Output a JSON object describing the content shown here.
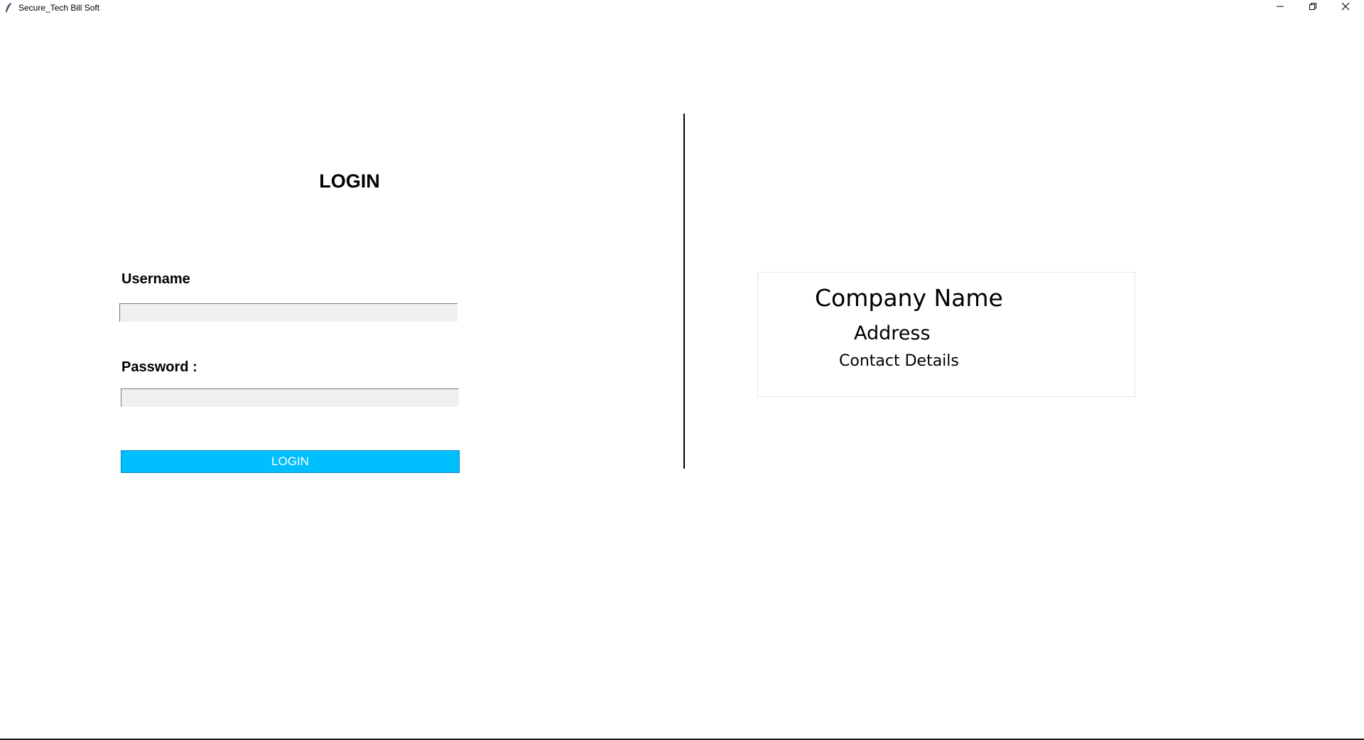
{
  "window": {
    "title": "Secure_Tech Bill Soft",
    "icon": "feather-icon",
    "controls": {
      "minimize_icon": "minimize-icon",
      "maximize_icon": "restore-icon",
      "close_icon": "close-icon"
    }
  },
  "login": {
    "heading": "LOGIN",
    "username_label": "Username",
    "username_value": "",
    "password_label": "Password :",
    "password_value": "",
    "button_label": "LOGIN"
  },
  "company": {
    "name": "Company Name",
    "address": "Address",
    "contact": "Contact Details"
  },
  "colors": {
    "button_bg": "#00bfff",
    "field_bg": "#f0f0f0",
    "background": "#ffffff",
    "text": "#000000"
  }
}
